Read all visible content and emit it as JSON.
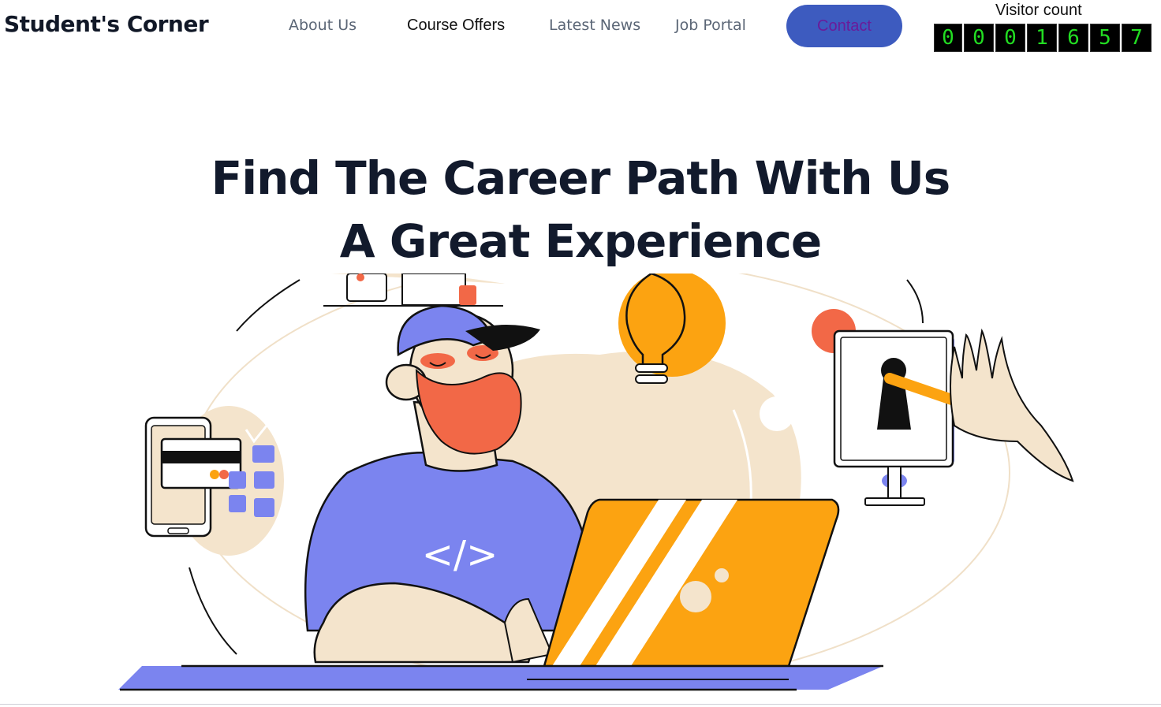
{
  "header": {
    "brand": "Student's Corner",
    "nav": [
      {
        "label": "About Us"
      },
      {
        "label": "Course Offers"
      },
      {
        "label": "Latest News"
      },
      {
        "label": "Job Portal"
      }
    ],
    "contact_label": "Contact",
    "visitor_label": "Visitor count",
    "visitor_digits": [
      "0",
      "0",
      "0",
      "1",
      "6",
      "5",
      "7"
    ]
  },
  "hero": {
    "line1": "Find The Career Path With Us",
    "line2": "A Great Experience",
    "code_glyph": "</>"
  },
  "colors": {
    "accent_blue": "#3d5bbf",
    "periwinkle": "#7b84ef",
    "orange": "#fca311",
    "coral": "#f26847",
    "beige": "#f4e4cc"
  }
}
